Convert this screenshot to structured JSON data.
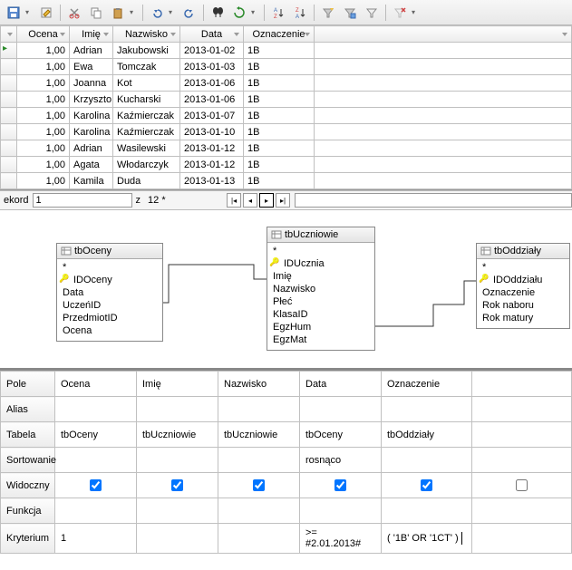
{
  "grid": {
    "columns": [
      "Ocena",
      "Imię",
      "Nazwisko",
      "Data",
      "Oznaczenie"
    ],
    "rows": [
      {
        "ocena": "1,00",
        "imie": "Adrian",
        "nazwisko": "Jakubowski",
        "data": "2013-01-02",
        "ozn": "1B"
      },
      {
        "ocena": "1,00",
        "imie": "Ewa",
        "nazwisko": "Tomczak",
        "data": "2013-01-03",
        "ozn": "1B"
      },
      {
        "ocena": "1,00",
        "imie": "Joanna",
        "nazwisko": "Kot",
        "data": "2013-01-06",
        "ozn": "1B"
      },
      {
        "ocena": "1,00",
        "imie": "Krzyszto",
        "nazwisko": "Kucharski",
        "data": "2013-01-06",
        "ozn": "1B"
      },
      {
        "ocena": "1,00",
        "imie": "Karolina",
        "nazwisko": "Kaźmierczak",
        "data": "2013-01-07",
        "ozn": "1B"
      },
      {
        "ocena": "1,00",
        "imie": "Karolina",
        "nazwisko": "Kaźmierczak",
        "data": "2013-01-10",
        "ozn": "1B"
      },
      {
        "ocena": "1,00",
        "imie": "Adrian",
        "nazwisko": "Wasilewski",
        "data": "2013-01-12",
        "ozn": "1B"
      },
      {
        "ocena": "1,00",
        "imie": "Agata",
        "nazwisko": "Włodarczyk",
        "data": "2013-01-12",
        "ozn": "1B"
      },
      {
        "ocena": "1,00",
        "imie": "Kamila",
        "nazwisko": "Duda",
        "data": "2013-01-13",
        "ozn": "1B"
      }
    ]
  },
  "recnav": {
    "label": "ekord",
    "value": "1",
    "of": "z",
    "total": "12 *"
  },
  "er": {
    "tbOceny": {
      "title": "tbOceny",
      "star": "*",
      "fields": [
        "IDOceny",
        "Data",
        "UczeńID",
        "PrzedmiotID",
        "Ocena"
      ],
      "key": 0
    },
    "tbUczniowie": {
      "title": "tbUczniowie",
      "star": "*",
      "fields": [
        "IDUcznia",
        "Imię",
        "Nazwisko",
        "Płeć",
        "KlasaID",
        "EgzHum",
        "EgzMat"
      ],
      "key": 0
    },
    "tbOddzialy": {
      "title": "tbOddziały",
      "star": "*",
      "fields": [
        "IDOddziału",
        "Oznaczenie",
        "Rok naboru",
        "Rok matury"
      ],
      "key": 0
    }
  },
  "design": {
    "rows": {
      "pole": "Pole",
      "alias": "Alias",
      "tabela": "Tabela",
      "sort": "Sortowanie",
      "widoczny": "Widoczny",
      "funkcja": "Funkcja",
      "kryt": "Kryterium"
    },
    "cols": [
      {
        "pole": "Ocena",
        "tabela": "tbOceny",
        "sort": "",
        "vis": true,
        "kryt": "1"
      },
      {
        "pole": "Imię",
        "tabela": "tbUczniowie",
        "sort": "",
        "vis": true,
        "kryt": ""
      },
      {
        "pole": "Nazwisko",
        "tabela": "tbUczniowie",
        "sort": "",
        "vis": true,
        "kryt": ""
      },
      {
        "pole": "Data",
        "tabela": "tbOceny",
        "sort": "rosnąco",
        "vis": true,
        "kryt": ">= #2.01.2013#"
      },
      {
        "pole": "Oznaczenie",
        "tabela": "tbOddziały",
        "sort": "",
        "vis": true,
        "kryt": "( '1B' OR '1CT' )"
      },
      {
        "pole": "",
        "tabela": "",
        "sort": "",
        "vis": false,
        "kryt": ""
      }
    ]
  }
}
